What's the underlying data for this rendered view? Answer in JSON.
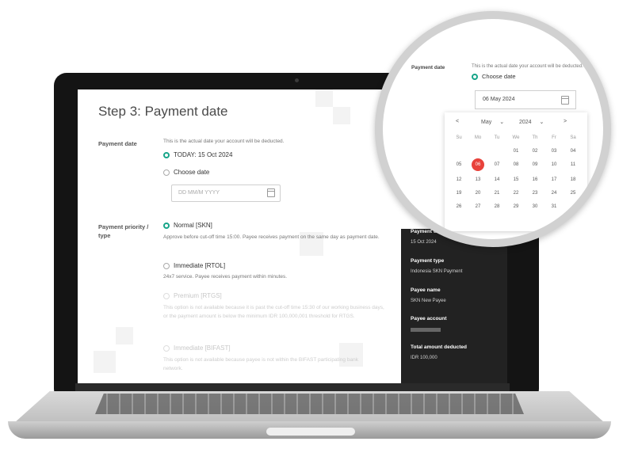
{
  "screen": {
    "step_title": "Step 3: Payment date",
    "payment_date_label": "Payment date",
    "payment_date_desc": "This is the actual date your account will be deducted.",
    "today_option": "TODAY: 15 Oct 2024",
    "choose_date_option": "Choose date",
    "date_placeholder": "DD MM/M YYYY",
    "priority_label": "Payment priority / type",
    "normal_option": "Normal [SKN]",
    "normal_desc": "Approve before cut-off time 15:00. Payee receives payment on the same day as payment date.",
    "immediate_option": "Immediate [RTOL]",
    "immediate_desc": "24x7 service. Payee receives payment within minutes.",
    "premium_option": "Premium [RTGS]",
    "premium_desc": "This option is not available because it is past the cut-off time 15:30 of our working business days, or the payment amount is below the minimum IDR 100,000,001 threshold for RTGS.",
    "bifast_option": "Immediate [BIFAST]",
    "bifast_desc": "This option is not available because payee is not within the BIFAST participating bank network."
  },
  "summary": {
    "payment_date_heading": "Payment date",
    "payment_date_value": "15 Oct 2024",
    "payment_type_heading": "Payment type",
    "payment_type_value": "Indonesia SKN Payment",
    "payee_name_heading": "Payee name",
    "payee_name_value": "SKN New Payee",
    "payee_account_heading": "Payee account",
    "total_heading": "Total amount deducted",
    "total_value": "IDR 100,000"
  },
  "magnifier": {
    "label": "Payment date",
    "desc": "This is the actual date your account will be deducted.",
    "choose_date": "Choose date",
    "date_value": "06 May 2024",
    "calendar": {
      "prev": "<",
      "next": ">",
      "month": "May",
      "year": "2024",
      "weekdays": [
        "Su",
        "Mo",
        "Tu",
        "We",
        "Th",
        "Fr",
        "Sa"
      ],
      "rows": [
        [
          "",
          "",
          "",
          "01",
          "02",
          "03",
          "04"
        ],
        [
          "05",
          "06",
          "07",
          "08",
          "09",
          "10",
          "11"
        ],
        [
          "12",
          "13",
          "14",
          "15",
          "16",
          "17",
          "18"
        ],
        [
          "19",
          "20",
          "21",
          "22",
          "23",
          "24",
          "25"
        ],
        [
          "26",
          "27",
          "28",
          "29",
          "30",
          "31",
          ""
        ]
      ],
      "selected": "06"
    }
  },
  "colors": {
    "accent": "#17a589",
    "selected_day": "#e8423b",
    "panel": "#222222"
  }
}
